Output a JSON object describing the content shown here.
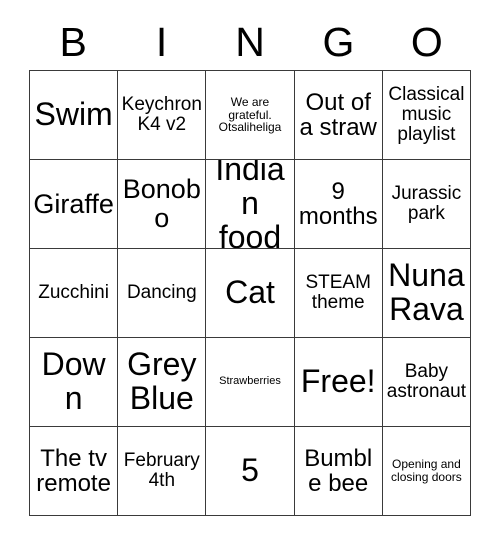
{
  "card": {
    "title": "BINGO",
    "header_letters": [
      "B",
      "I",
      "N",
      "G",
      "O"
    ],
    "colors": {
      "background": "#ffffff",
      "text": "#000000",
      "grid_line": "#3a3a3a"
    },
    "rows": [
      [
        {
          "text": "Swim",
          "size": "xxl"
        },
        {
          "text": "Keychron K4 v2",
          "size": "md"
        },
        {
          "text": "We are grateful. Otsaliheliga",
          "size": "xs"
        },
        {
          "text": "Out of a straw",
          "size": "lg"
        },
        {
          "text": "Classical music playlist",
          "size": "md"
        }
      ],
      [
        {
          "text": "Giraffe",
          "size": "xl"
        },
        {
          "text": "Bonobo",
          "size": "xl"
        },
        {
          "text": "Indian food",
          "size": "xxl"
        },
        {
          "text": "9 months",
          "size": "lg"
        },
        {
          "text": "Jurassic park",
          "size": "md"
        }
      ],
      [
        {
          "text": "Zucchini",
          "size": "md"
        },
        {
          "text": "Dancing",
          "size": "md"
        },
        {
          "text": "Cat",
          "size": "xxl"
        },
        {
          "text": "STEAM theme",
          "size": "md"
        },
        {
          "text": "Nuna Rava",
          "size": "xxl"
        }
      ],
      [
        {
          "text": "Down",
          "size": "xxl"
        },
        {
          "text": "Grey Blue",
          "size": "xxl"
        },
        {
          "text": "Strawberries",
          "size": "xxs"
        },
        {
          "text": "Free!",
          "size": "xxl"
        },
        {
          "text": "Baby astronaut",
          "size": "md"
        }
      ],
      [
        {
          "text": "The tv remote",
          "size": "lg"
        },
        {
          "text": "February 4th",
          "size": "md"
        },
        {
          "text": "5",
          "size": "xxl"
        },
        {
          "text": "Bumble bee",
          "size": "lg"
        },
        {
          "text": "Opening and closing doors",
          "size": "xs"
        }
      ]
    ]
  }
}
